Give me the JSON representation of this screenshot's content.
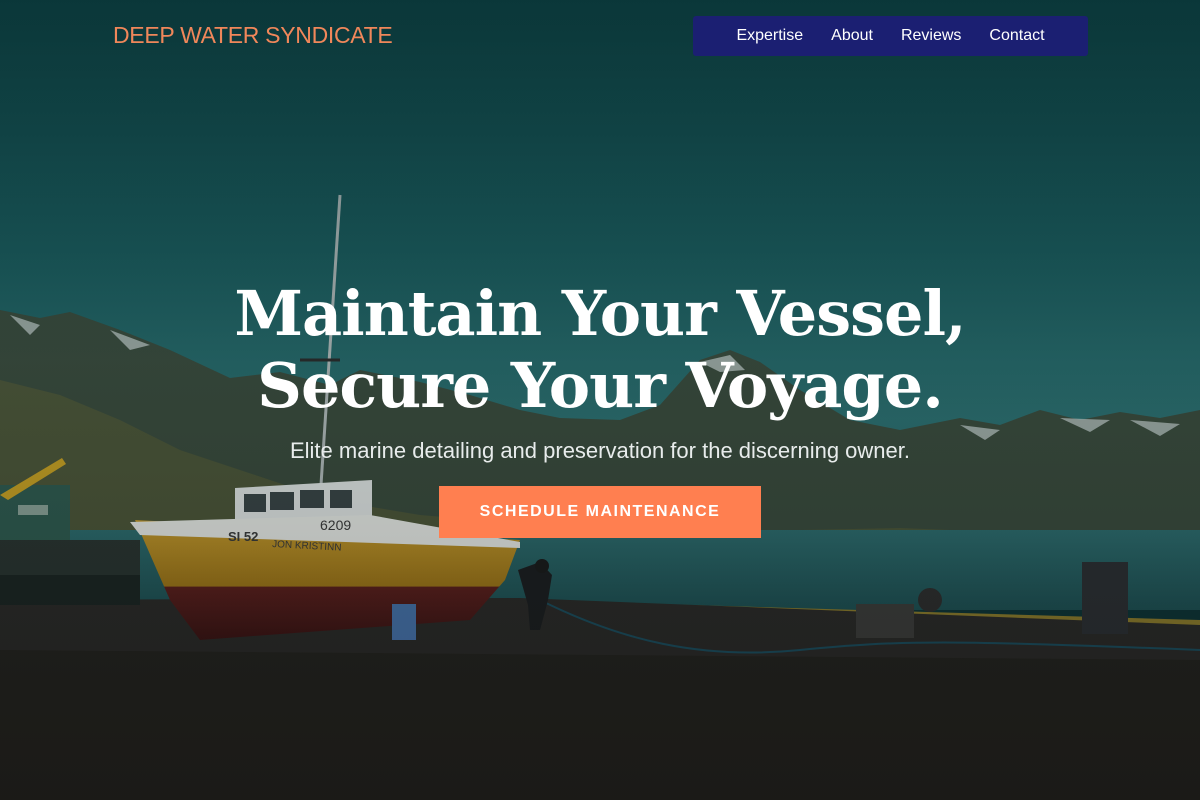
{
  "brand": {
    "name": "DEEP WATER SYNDICATE"
  },
  "nav": {
    "items": [
      {
        "label": "Expertise"
      },
      {
        "label": "About"
      },
      {
        "label": "Reviews"
      },
      {
        "label": "Contact"
      }
    ]
  },
  "hero": {
    "headline_line1": "Maintain Your Vessel,",
    "headline_line2": "Secure Your Voyage.",
    "subhead": "Elite marine detailing and preservation for the discerning owner.",
    "cta_label": "SCHEDULE MAINTENANCE"
  },
  "boat": {
    "hull_number": "6209",
    "registration": "SI 52",
    "name": "JON KRISTINN"
  },
  "colors": {
    "brand_accent": "#f0875a",
    "nav_background": "#1b1f72",
    "cta_background": "#ff7f50"
  }
}
